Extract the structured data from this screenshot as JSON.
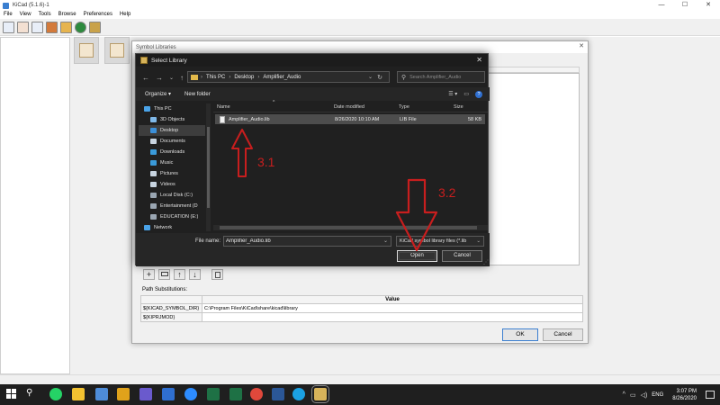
{
  "kicad": {
    "title": "KiCad (5.1.6)-1",
    "menu": [
      "File",
      "View",
      "Tools",
      "Browse",
      "Preferences",
      "Help"
    ]
  },
  "symbol_libraries": {
    "title": "Symbol Libraries",
    "tool_icons": [
      "add-icon",
      "folder-icon",
      "arrow-up-icon",
      "arrow-down-icon",
      "trash-icon"
    ],
    "add_glyph": "+",
    "up_glyph": "↑",
    "down_glyph": "↓",
    "path_substitutions_label": "Path Substitutions:",
    "value_header": "Value",
    "rows": [
      {
        "key": "${KICAD_SYMBOL_DIR}",
        "value": "C:\\Program Files\\KiCad\\share\\kicad\\library"
      },
      {
        "key": "${KIPRJMOD}",
        "value": ""
      }
    ],
    "ok_label": "OK",
    "cancel_label": "Cancel"
  },
  "select_library": {
    "title": "Select Library",
    "breadcrumb": [
      "This PC",
      "Desktop",
      "Amplifier_Audio"
    ],
    "search_placeholder": "Search Amplifier_Audio",
    "organize_label": "Organize ▾",
    "new_folder_label": "New folder",
    "nav_items": [
      {
        "label": "This PC",
        "color": "#4aa3e8"
      },
      {
        "label": "3D Objects",
        "color": "#7fb8e8"
      },
      {
        "label": "Desktop",
        "color": "#3b8fd8"
      },
      {
        "label": "Documents",
        "color": "#c8d4e0"
      },
      {
        "label": "Downloads",
        "color": "#3a9ad9"
      },
      {
        "label": "Music",
        "color": "#3a9ad9"
      },
      {
        "label": "Pictures",
        "color": "#c8d4e0"
      },
      {
        "label": "Videos",
        "color": "#c8d4e0"
      },
      {
        "label": "Local Disk (C:)",
        "color": "#9aa6b2"
      },
      {
        "label": "Entertainment (D",
        "color": "#9aa6b2"
      },
      {
        "label": "EDUCATION (E:)",
        "color": "#9aa6b2"
      },
      {
        "label": "Network",
        "color": "#4aa3e8"
      }
    ],
    "columns": {
      "name": "Name",
      "date": "Date modified",
      "type": "Type",
      "size": "Size"
    },
    "files": [
      {
        "name": "Amplifier_Audio.lib",
        "date": "8/26/2020 10:10 AM",
        "type": "LIB File",
        "size": "58 KB"
      }
    ],
    "file_name_label": "File name:",
    "file_name_value": "Amplifier_Audio.lib",
    "file_type": "KiCad symbol library files (*.lib",
    "open_label": "Open",
    "cancel_label": "Cancel"
  },
  "annotations": [
    {
      "label": "3.1",
      "color": "#c81e1e"
    },
    {
      "label": "3.2",
      "color": "#c81e1e"
    }
  ],
  "taskbar": {
    "language": "ENG",
    "time": "3:07 PM",
    "date": "8/26/2020",
    "apps": [
      {
        "name": "whatsapp",
        "color": "#25d366"
      },
      {
        "name": "file-explorer",
        "color": "#f2c231"
      },
      {
        "name": "paint",
        "color": "#4e8cd8"
      },
      {
        "name": "app-m",
        "color": "#e0a21b"
      },
      {
        "name": "app-dots",
        "color": "#6a5acd"
      },
      {
        "name": "app-blue-dots",
        "color": "#2f6fd0"
      },
      {
        "name": "zoom",
        "color": "#2d8cff"
      },
      {
        "name": "excel-like",
        "color": "#1e7145"
      },
      {
        "name": "chrome",
        "color": "#e0483b"
      },
      {
        "name": "edge",
        "color": "#1ba1e2"
      },
      {
        "name": "word",
        "color": "#2b5797"
      },
      {
        "name": "kicad",
        "color": "#d7b35a"
      }
    ]
  }
}
